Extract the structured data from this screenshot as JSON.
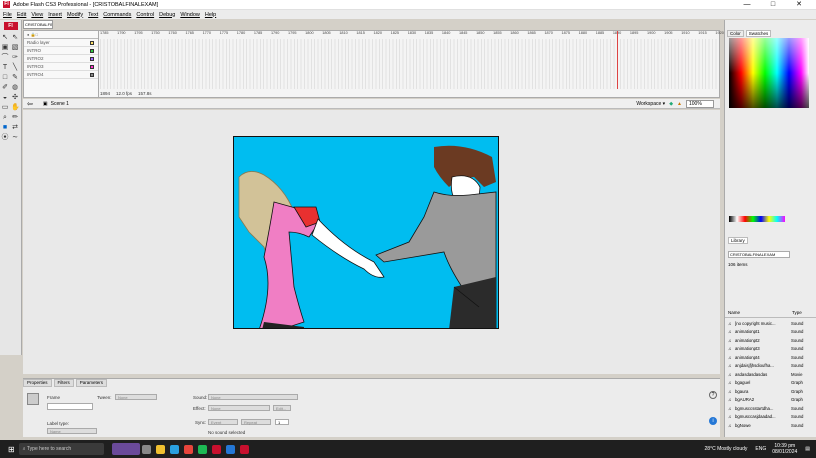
{
  "window": {
    "title": "Adobe Flash CS3 Professional - [CRISTOBALFINALEXAM]",
    "minimize": "—",
    "maximize": "□",
    "close": "✕"
  },
  "menu": [
    "File",
    "Edit",
    "View",
    "Insert",
    "Modify",
    "Text",
    "Commands",
    "Control",
    "Debug",
    "Window",
    "Help"
  ],
  "doc_tab": "CRISTOBALFINALEXAM",
  "layers": [
    {
      "name": "Radio layer",
      "color": "#ffe066"
    },
    {
      "name": "INTRO",
      "color": "#2ecc40"
    },
    {
      "name": "INTRO2",
      "color": "#a066ff"
    },
    {
      "name": "INTRO3",
      "color": "#ff33cc"
    },
    {
      "name": "INTRO4",
      "color": "#888888"
    }
  ],
  "ruler": [
    "1785",
    "1790",
    "1795",
    "1750",
    "1760",
    "1765",
    "1770",
    "1775",
    "1780",
    "1785",
    "1790",
    "1795",
    "1800",
    "1805",
    "1810",
    "1815",
    "1820",
    "1825",
    "1830",
    "1835",
    "1840",
    "1845",
    "1850",
    "1855",
    "1860",
    "1865",
    "1870",
    "1875",
    "1880",
    "1885",
    "1890",
    "1895",
    "1900",
    "1905",
    "1910",
    "1915",
    "1920"
  ],
  "timeline_status": {
    "frame": "1894",
    "fps": "12.0 fps",
    "time": "157.8s"
  },
  "editbar": {
    "scene": "Scene 1",
    "workspace": "Workspace ▾",
    "zoom": "100%"
  },
  "props": {
    "tabs": [
      "Properties",
      "Filters",
      "Parameters"
    ],
    "frame_label": "Frame",
    "tween_label": "Tween:",
    "tween_value": "None",
    "label_type": "Label type:",
    "label_type_value": "Name",
    "sound_label": "Sound:",
    "sound_value": "None",
    "effect_label": "Effect:",
    "effect_value": "None",
    "edit_btn": "Edit...",
    "sync_label": "Sync:",
    "sync_value": "Event",
    "repeat_value": "Repeat",
    "repeat_count": "1",
    "no_sound": "No sound selected"
  },
  "color_tabs": [
    "Color",
    "Swatches"
  ],
  "library": {
    "tab": "Library",
    "doc": "CRISTOBALFINALEXAM",
    "count": "106 items",
    "col_name": "Name",
    "col_type": "Type",
    "items": [
      {
        "name": "[no copyright music...",
        "type": "Sound"
      },
      {
        "name": "animationpt1",
        "type": "Sound"
      },
      {
        "name": "animationpt2",
        "type": "Sound"
      },
      {
        "name": "animationpt3",
        "type": "Sound"
      },
      {
        "name": "animationpt4",
        "type": "Sound"
      },
      {
        "name": "anjdaisjfjhsdioufha...",
        "type": "Sound"
      },
      {
        "name": "asdasdasdasdas",
        "type": "Movie"
      },
      {
        "name": "bgaguel",
        "type": "Graph"
      },
      {
        "name": "bgaura",
        "type": "Graph"
      },
      {
        "name": "bgAURA2",
        "type": "Graph"
      },
      {
        "name": "bgmusccsstartdha...",
        "type": "Sound"
      },
      {
        "name": "bgmusccasjdaadad...",
        "type": "Sound"
      },
      {
        "name": "bgNowe",
        "type": "Sound"
      }
    ]
  },
  "taskbar": {
    "search": "Type here to search",
    "weather": "28°C  Mostly cloudy",
    "lang": "ENG",
    "time": "10:39 pm",
    "date": "08/01/2024"
  },
  "colors": {
    "stage": "#00bdf0",
    "flash_red": "#c8102e"
  }
}
